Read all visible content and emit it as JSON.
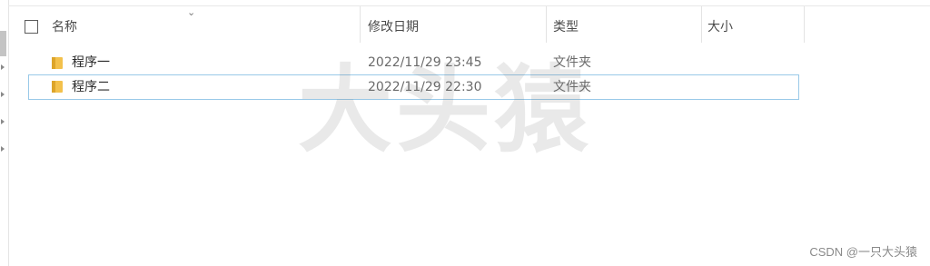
{
  "header": {
    "columns": [
      {
        "label": "名称"
      },
      {
        "label": "修改日期"
      },
      {
        "label": "类型"
      },
      {
        "label": "大小"
      }
    ]
  },
  "rows": [
    {
      "name": "程序一",
      "modified": "2022/11/29 23:45",
      "type": "文件夹",
      "size": ""
    },
    {
      "name": "程序二",
      "modified": "2022/11/29 22:30",
      "type": "文件夹",
      "size": ""
    }
  ],
  "watermark": {
    "text": "大头猿"
  },
  "credit": {
    "text": "CSDN @一只大头猿"
  },
  "colors": {
    "selection_border": "#99c9e8",
    "folder": "#f3c14c",
    "folder_dark": "#dda52a"
  },
  "icons": {
    "folder": "folder-icon",
    "sort": "chevron-down-icon"
  }
}
